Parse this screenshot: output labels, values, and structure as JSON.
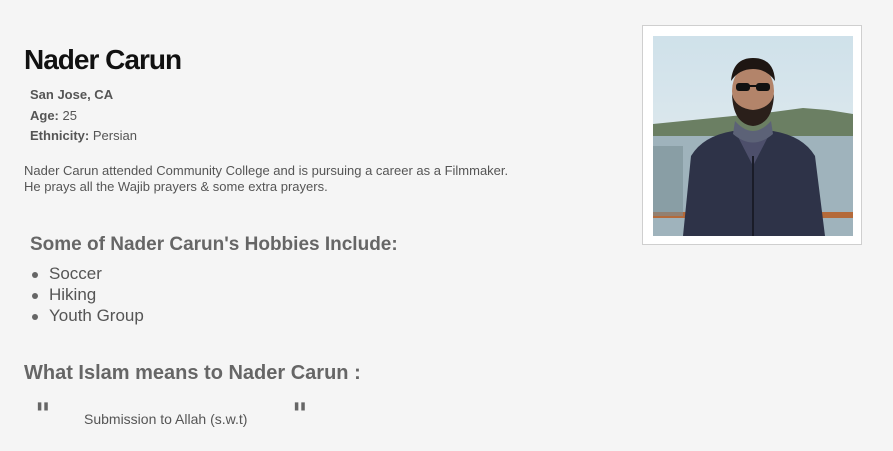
{
  "profile": {
    "name": "Nader Carun",
    "location": "San Jose, CA",
    "age_label": "Age:",
    "age": "25",
    "ethnicity_label": "Ethnicity:",
    "ethnicity": "Persian",
    "bio_line1": "Nader Carun attended Community College and is pursuing a career as a Filmmaker.",
    "bio_line2": "He prays all the Wajib prayers & some extra prayers."
  },
  "hobbies": {
    "title": "Some of Nader Carun's Hobbies Include:",
    "items": [
      "Soccer",
      "Hiking",
      "Youth Group"
    ]
  },
  "islam": {
    "title": "What Islam means to Nader Carun :",
    "open_quote": "\"",
    "quote": "Submission to Allah (s.w.t)",
    "close_quote": "\""
  }
}
